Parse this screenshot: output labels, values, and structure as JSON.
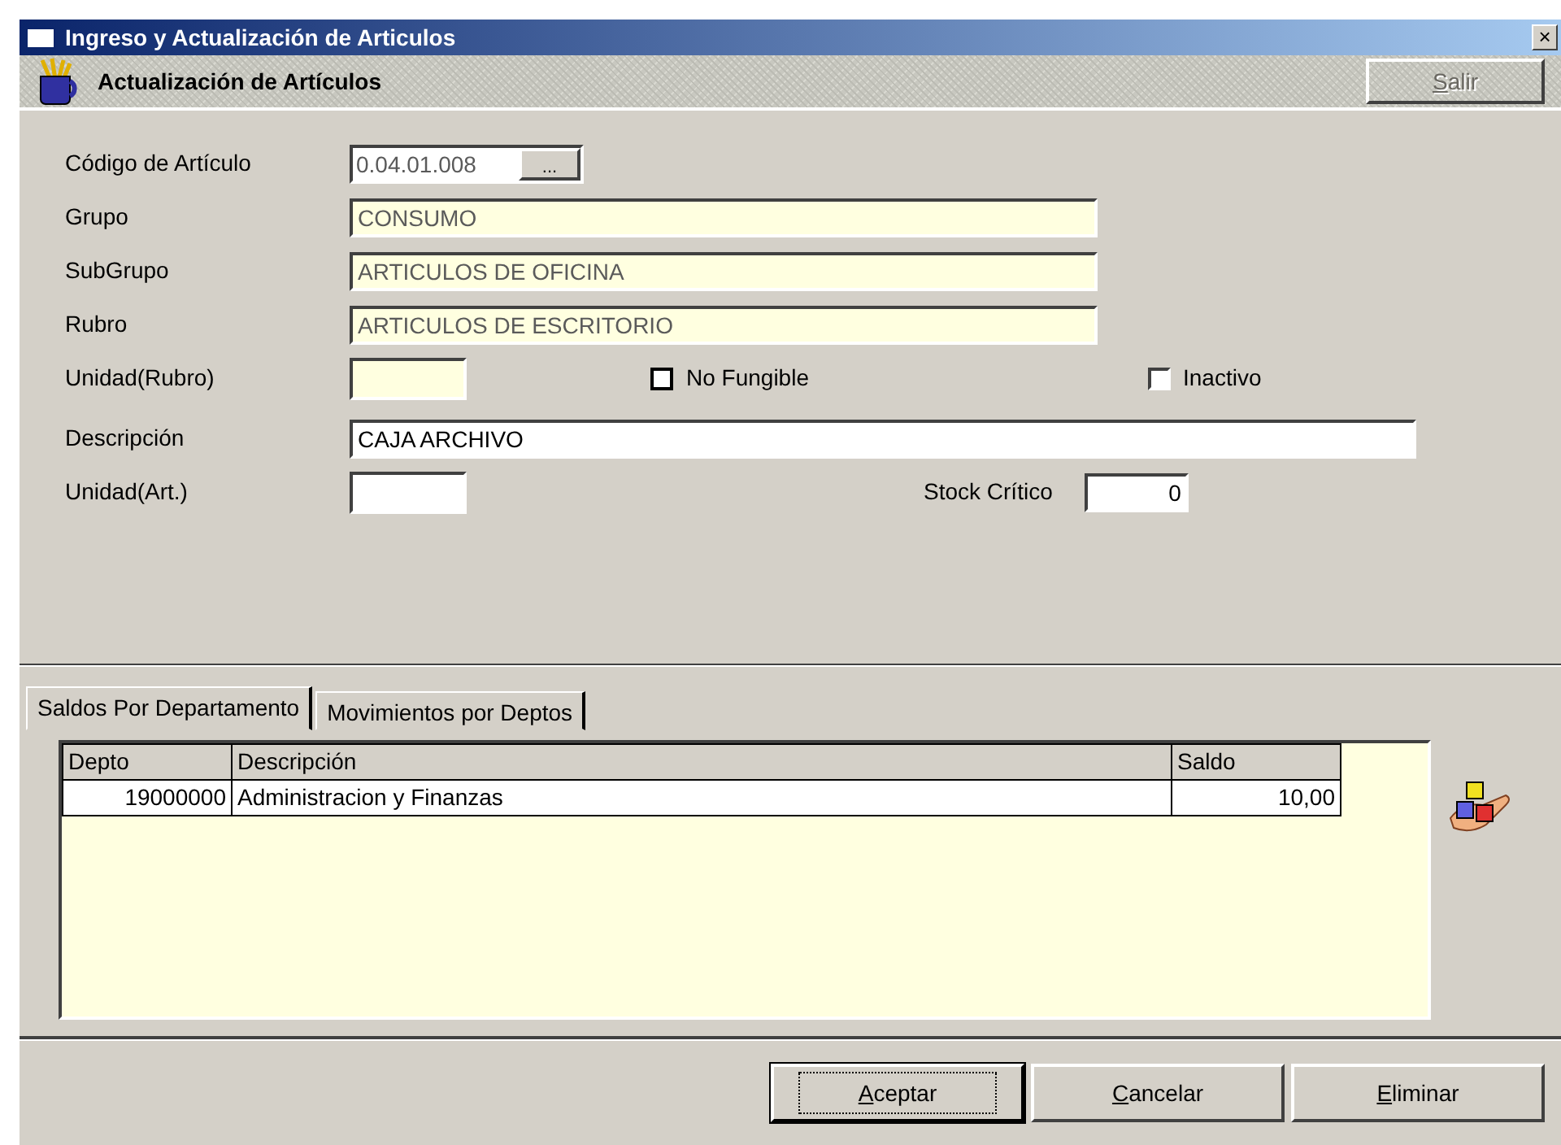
{
  "window": {
    "title": "Ingreso y Actualización de Articulos",
    "close": "×"
  },
  "header": {
    "title": "Actualización de Artículos",
    "exit_button": {
      "key": "S",
      "rest": "alir",
      "disabled": true
    }
  },
  "form": {
    "codigo": {
      "label": "Código de Artículo",
      "value": "0.04.01.008",
      "browse": "..."
    },
    "grupo": {
      "label": "Grupo",
      "value": "CONSUMO"
    },
    "subgrupo": {
      "label": "SubGrupo",
      "value": "ARTICULOS DE OFICINA"
    },
    "rubro": {
      "label": "Rubro",
      "value": "ARTICULOS DE ESCRITORIO"
    },
    "unidad_rubro": {
      "label": "Unidad(Rubro)"
    },
    "no_fungible": {
      "label": "No Fungible",
      "checked": false
    },
    "inactivo": {
      "label": "Inactivo",
      "checked": false
    },
    "descripcion": {
      "label": "Descripción",
      "value": "CAJA ARCHIVO"
    },
    "unidad_art": {
      "label": "Unidad(Art.)"
    },
    "stock_critico": {
      "label": "Stock Crítico",
      "value": "0"
    }
  },
  "tabs": [
    {
      "label": "Saldos Por Departamento",
      "selected": true
    },
    {
      "label": "Movimientos por Deptos",
      "selected": false
    }
  ],
  "table": {
    "columns": [
      "Depto",
      "Descripción",
      "Saldo"
    ],
    "rows": [
      [
        "19000000",
        "Administracion y Finanzas",
        "10,00"
      ]
    ]
  },
  "buttons": [
    {
      "key": "A",
      "rest": "ceptar",
      "focused": true
    },
    {
      "key": "C",
      "rest": "ancelar",
      "focused": false
    },
    {
      "key": "E",
      "rest": "liminar",
      "focused": false
    }
  ]
}
